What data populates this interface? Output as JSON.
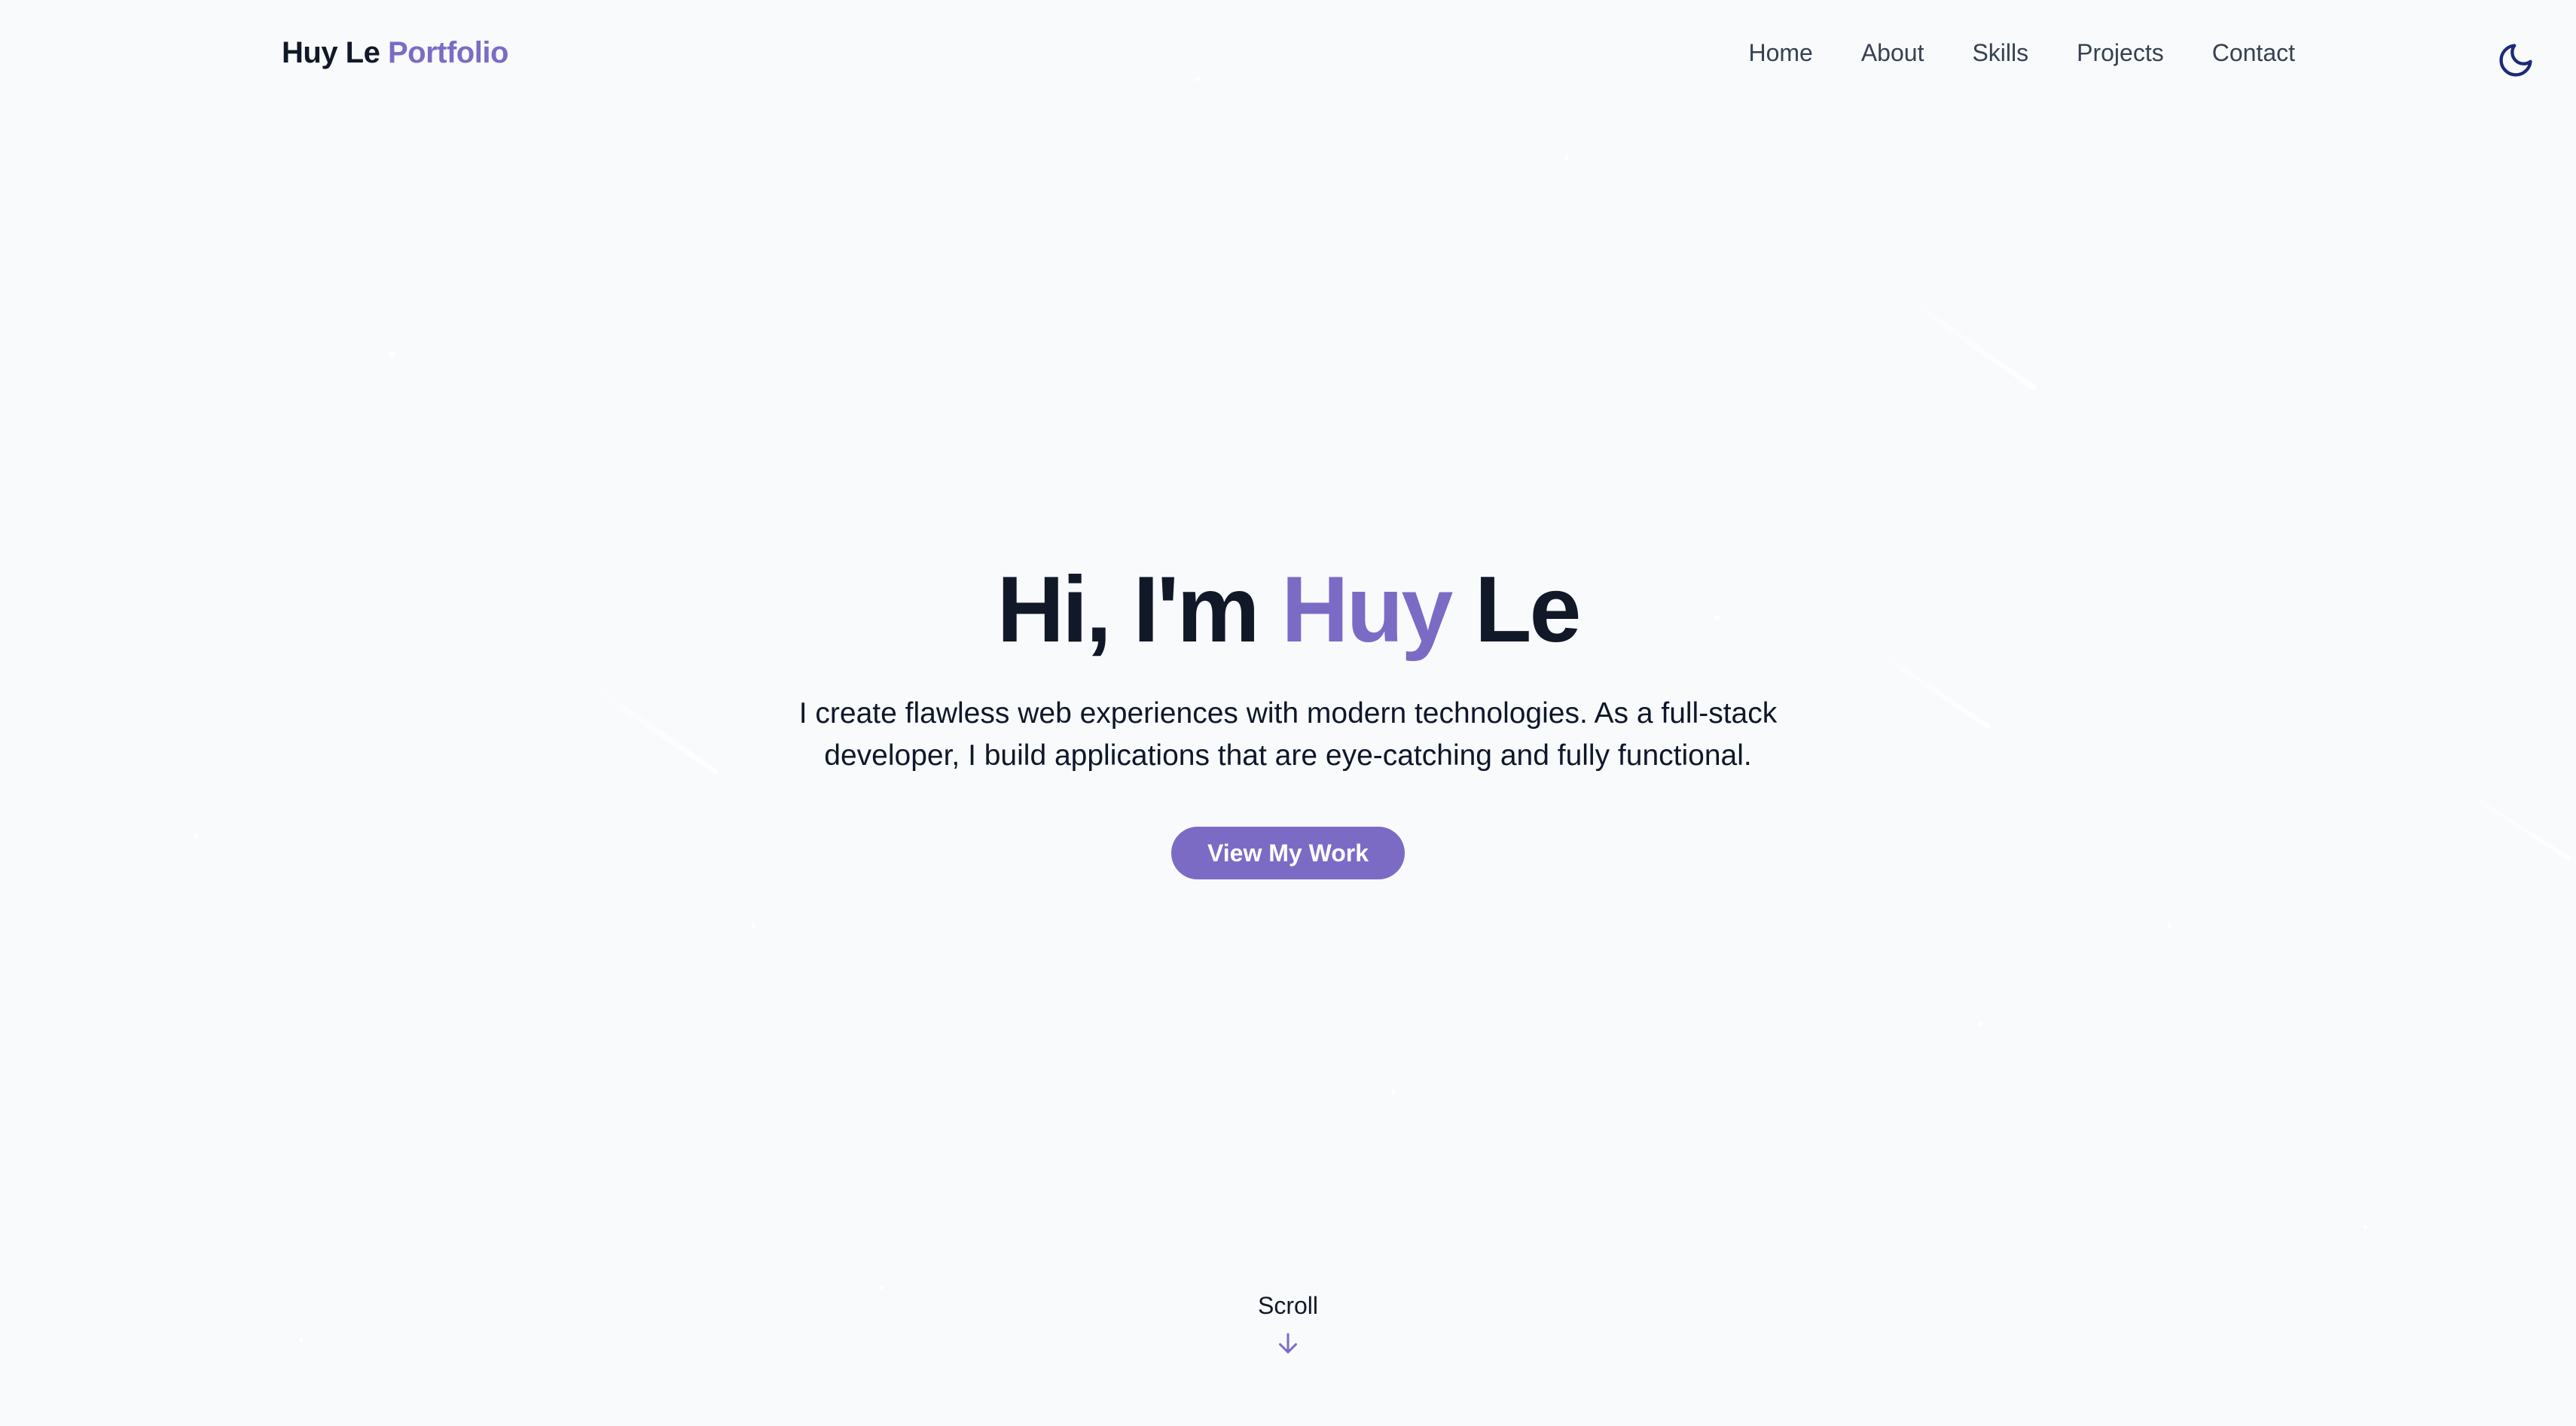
{
  "header": {
    "logo_first": "Huy Le",
    "logo_accent": "Portfolio",
    "nav_items": [
      "Home",
      "About",
      "Skills",
      "Projects",
      "Contact"
    ],
    "theme_toggle_icon": "moon-icon"
  },
  "hero": {
    "greeting": "Hi, I'm",
    "name_first": "Huy",
    "name_last": "Le",
    "subtitle_line1": "I create flawless web experiences with modern technologies. As a full-stack",
    "subtitle_line2": "developer, I build applications that are eye-catching and fully functional.",
    "cta_label": "View My Work"
  },
  "scroll": {
    "label": "Scroll",
    "icon": "arrow-down-icon"
  },
  "colors": {
    "background": "#f8fafc",
    "accent": "#7c6bc4",
    "heading": "#111827",
    "nav_text": "#374151"
  }
}
